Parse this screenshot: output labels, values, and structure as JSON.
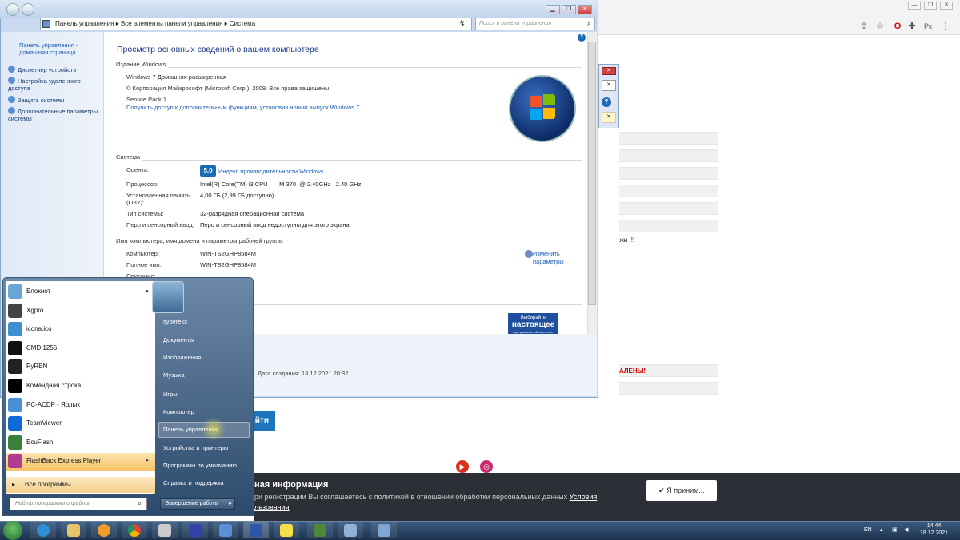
{
  "browser": {
    "controls": [
      "—",
      "❐",
      "✕"
    ],
    "toolbar_icons": [
      "share-icon",
      "star-icon",
      "opera-icon",
      "extensions-icon",
      "vk-icon",
      "menu-icon"
    ],
    "notice_title": "ная информация",
    "notice_text": "ри регистрации Вы соглашаетесь с политикой в отношении обработки персональных данных",
    "notice_link": "Условия",
    "notice_link2": "льзования",
    "accept_label": "✔ Я приним...",
    "button_label": "йти",
    "partial_text1": "ажи !!!",
    "partial_text2": "АЛЕНЫ!"
  },
  "window": {
    "breadcrumb": [
      "Панель управления",
      "Все элементы панели управления",
      "Система"
    ],
    "search_placeholder": "Поиск в панели управления",
    "left_nav": {
      "home": "Панель управления - домашняя страница",
      "items": [
        "Диспетчер устройств",
        "Настройка удаленного доступа",
        "Защита системы",
        "Дополнительные параметры системы"
      ]
    },
    "heading": "Просмотр основных сведений о вашем компьютере",
    "edition_section": "Издание Windows",
    "edition": "Windows 7 Домашняя расширенная",
    "copyright": "© Корпорация Майкрософт (Microsoft Corp.), 2009. Все права защищены.",
    "sp": "Service Pack 1",
    "sp_link": "Получить доступ к дополнительным функциям, установив новый выпуск Windows 7",
    "system_section": "Система",
    "rating_label": "Оценка:",
    "rating_value": "5,0",
    "rating_link": "Индекс производительности Windows",
    "cpu_label": "Процессор:",
    "cpu_value": "Intel(R) Core(TM) i3 CPU       M 370  @ 2.40GHz   2.40 GHz",
    "ram_label": "Установленная память (ОЗУ):",
    "ram_value": "4,00 ГБ (2,99 ГБ доступно)",
    "type_label": "Тип системы:",
    "type_value": "32-разрядная операционная система",
    "pen_label": "Перо и сенсорный ввод:",
    "pen_value": "Перо и сенсорный ввод недоступны для этого экрана",
    "name_section": "Имя компьютера, имя домена и параметры рабочей группы",
    "computer_label": "Компьютер:",
    "computer_value": "WIN-TS2GHP8584M",
    "fullname_label": "Полное имя:",
    "fullname_value": "WIN-TS2GHP8584M",
    "desc_label": "Описание:",
    "change_link": "Изменить параметры",
    "genuine_top": "Выбирайте",
    "genuine_mid": "настоящее",
    "genuine_bot": "программное обеспечение",
    "created": "Дата создания: 13.12.2021 20:32"
  },
  "start_menu": {
    "programs": [
      {
        "label": "Блокнот",
        "color": "#6aa5d8",
        "arrow": true
      },
      {
        "label": "Xgpro",
        "color": "#444",
        "arrow": false
      },
      {
        "label": "icona.ico",
        "color": "#3d8fd1",
        "arrow": false
      },
      {
        "label": "CMD 1255",
        "color": "#111",
        "arrow": false
      },
      {
        "label": "PyREN",
        "color": "#222",
        "arrow": false
      },
      {
        "label": "Командная строка",
        "color": "#000",
        "arrow": false
      },
      {
        "label": "PC-ACDP - Ярлык",
        "color": "#4a90d9",
        "arrow": false
      },
      {
        "label": "TeamViewer",
        "color": "#0e6bd6",
        "arrow": false
      },
      {
        "label": "EcuFlash",
        "color": "#3a7f3a",
        "arrow": false
      },
      {
        "label": "FlashBack Express Player",
        "color": "#b03d8f",
        "arrow": true
      }
    ],
    "all_programs": "Все программы",
    "search_placeholder": "Найти программы и файлы",
    "right_items": [
      "sybereks",
      "Документы",
      "Изображения",
      "Музыка",
      "Игры",
      "Компьютер",
      "Панель управления",
      "Устройства и принтеры",
      "Программы по умолчанию",
      "Справка и поддержка"
    ],
    "shutdown": "Завершение работы"
  },
  "taskbar": {
    "lang": "EN",
    "time": "14:44",
    "date": "18.12.2021"
  }
}
